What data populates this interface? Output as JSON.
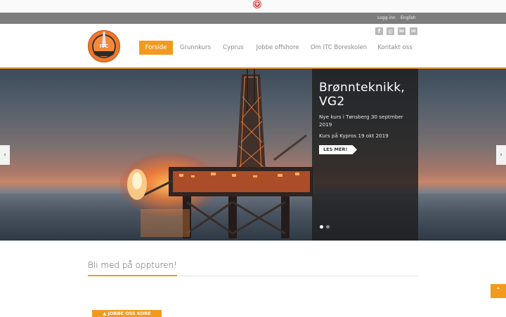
{
  "top_strip": {
    "icon": "flag-icon"
  },
  "utility_bar": {
    "login": "Logg inn",
    "language": "English"
  },
  "social": [
    {
      "name": "facebook-icon",
      "glyph": "f"
    },
    {
      "name": "instagram-icon",
      "glyph": "◎"
    },
    {
      "name": "linkedin-icon",
      "glyph": "in"
    },
    {
      "name": "email-icon",
      "glyph": "✉"
    }
  ],
  "logo": {
    "text": "ITC",
    "alt": "ITC Boreskolen logo"
  },
  "nav": {
    "items": [
      {
        "label": "Forside",
        "active": true
      },
      {
        "label": "Grunnkurs",
        "active": false
      },
      {
        "label": "Cyprus",
        "active": false
      },
      {
        "label": "Jobbe offshore",
        "active": false
      },
      {
        "label": "Om ITC Boreskolen",
        "active": false
      },
      {
        "label": "Kontakt oss",
        "active": false
      }
    ]
  },
  "hero": {
    "title": "Brønnteknikk, VG2",
    "line1": "Nye kurs i Tønsberg 30 septmber 2019",
    "line2": "Kurs på Kypros 19 okt 2019",
    "button": "LES MER!",
    "prev_glyph": "‹",
    "next_glyph": "›",
    "slide_count": 2,
    "active_slide": 1
  },
  "section": {
    "title": "Bli med på oppturen!"
  },
  "scroll_top_glyph": "⌃",
  "cta": {
    "label": "▲ JOBBE OSS KORE"
  },
  "colors": {
    "accent": "#f39a1e",
    "utility_bar": "#7d7d7d",
    "caption_bg": "#1e1e1e",
    "nav_text": "#8a8a8a"
  }
}
